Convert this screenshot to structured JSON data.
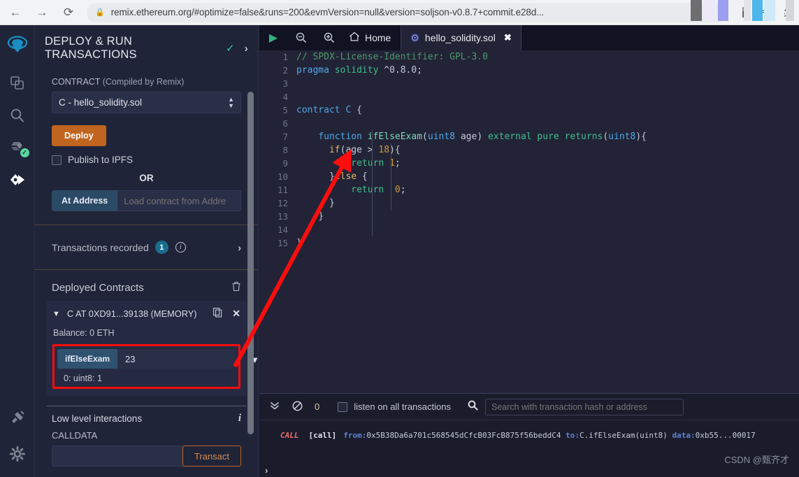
{
  "browser": {
    "back_icon": "back-arrow-icon",
    "forward_icon": "forward-arrow-icon",
    "reload_icon": "reload-icon",
    "lock_icon": "lock-icon",
    "url": "remix.ethereum.org/#optimize=false&runs=200&evmVersion=null&version=soljson-v0.8.7+commit.e28d...",
    "translate_icon": "translate-icon",
    "share_icon": "share-icon",
    "bookmark_icon": "star-icon"
  },
  "rail": {
    "items": [
      {
        "name": "remix-logo",
        "glyph": "◉"
      },
      {
        "name": "file-explorer-icon",
        "glyph": "❐"
      },
      {
        "name": "search-icon",
        "glyph": "⌕"
      },
      {
        "name": "solidity-compiler-icon",
        "glyph": "⚙",
        "badge": "✓"
      },
      {
        "name": "deploy-run-icon",
        "glyph": "◈"
      },
      {
        "name": "plugin-manager-icon",
        "glyph": "⚡"
      },
      {
        "name": "settings-icon",
        "glyph": "⚙"
      }
    ]
  },
  "sidebar": {
    "title": "DEPLOY & RUN TRANSACTIONS",
    "title_check": "✓",
    "title_chevron": "›",
    "contract_label": "CONTRACT",
    "contract_sub": "(Compiled by Remix)",
    "contract_value": "C - hello_solidity.sol",
    "deploy_label": "Deploy",
    "publish_ipfs_label": "Publish to IPFS",
    "or_label": "OR",
    "at_address_label": "At Address",
    "at_address_placeholder": "Load contract from Addre",
    "transactions_recorded_label": "Transactions recorded",
    "transactions_recorded_count": "1",
    "deployed_contracts_label": "Deployed Contracts",
    "contract_instance": "C AT 0XD91...39138 (MEMORY)",
    "balance": "Balance: 0 ETH",
    "fn_name": "ifElseExam",
    "fn_arg_value": "23",
    "fn_result": "0: uint8: 1",
    "low_level_label": "Low level interactions",
    "calldata_label": "CALLDATA",
    "calldata_value": "",
    "transact_label": "Transact"
  },
  "editor": {
    "run_icon": "run-script-icon",
    "zoom_out_icon": "zoom-out-icon",
    "zoom_in_icon": "zoom-in-icon",
    "home_icon": "home-icon",
    "home_label": "Home",
    "tab_label": "hello_solidity.sol",
    "tab_close": "✖",
    "lines": [
      {
        "n": "1",
        "tokens": [
          {
            "t": "// SPDX-License-Identifier: GPL-3.0",
            "c": "c-com"
          }
        ]
      },
      {
        "n": "2",
        "tokens": [
          {
            "t": "pragma ",
            "c": "c-key"
          },
          {
            "t": "solidity ",
            "c": "c-mod"
          },
          {
            "t": "^0.8.0;",
            "c": "c-punct"
          }
        ]
      },
      {
        "n": "3",
        "tokens": []
      },
      {
        "n": "4",
        "tokens": []
      },
      {
        "n": "5",
        "tokens": [
          {
            "t": "contract ",
            "c": "c-key"
          },
          {
            "t": "C ",
            "c": "c-type"
          },
          {
            "t": "{",
            "c": "c-punct"
          }
        ]
      },
      {
        "n": "6",
        "tokens": []
      },
      {
        "n": "7",
        "tokens": [
          {
            "t": "    ",
            "c": ""
          },
          {
            "t": "function ",
            "c": "c-key"
          },
          {
            "t": "ifElseExam",
            "c": "c-fn"
          },
          {
            "t": "(",
            "c": "c-punct"
          },
          {
            "t": "uint8",
            "c": "c-type"
          },
          {
            "t": " age) ",
            "c": "c-punct"
          },
          {
            "t": "external pure ",
            "c": "c-mod"
          },
          {
            "t": "returns",
            "c": "c-ret"
          },
          {
            "t": "(",
            "c": "c-punct"
          },
          {
            "t": "uint8",
            "c": "c-type"
          },
          {
            "t": "){",
            "c": "c-punct"
          }
        ]
      },
      {
        "n": "8",
        "tokens": [
          {
            "t": "      ",
            "c": ""
          },
          {
            "t": "if",
            "c": "c-ctl"
          },
          {
            "t": "(age > ",
            "c": "c-punct"
          },
          {
            "t": "18",
            "c": "c-num"
          },
          {
            "t": "){",
            "c": "c-punct"
          }
        ]
      },
      {
        "n": "9",
        "tokens": [
          {
            "t": "          ",
            "c": ""
          },
          {
            "t": "return ",
            "c": "c-ret"
          },
          {
            "t": "1",
            "c": "c-num"
          },
          {
            "t": ";",
            "c": "c-punct"
          }
        ]
      },
      {
        "n": "10",
        "tokens": [
          {
            "t": "      ",
            "c": ""
          },
          {
            "t": "}",
            "c": "c-punct"
          },
          {
            "t": "else",
            "c": "c-ctl"
          },
          {
            "t": " {",
            "c": "c-punct"
          }
        ]
      },
      {
        "n": "11",
        "tokens": [
          {
            "t": "          ",
            "c": ""
          },
          {
            "t": "return ",
            "c": "c-ret"
          },
          {
            "t": " 0",
            "c": "c-num"
          },
          {
            "t": ";",
            "c": "c-punct"
          }
        ]
      },
      {
        "n": "12",
        "tokens": [
          {
            "t": "      ",
            "c": ""
          },
          {
            "t": "}",
            "c": "c-punct"
          }
        ]
      },
      {
        "n": "13",
        "tokens": [
          {
            "t": "    ",
            "c": ""
          },
          {
            "t": "}",
            "c": "c-punct"
          }
        ]
      },
      {
        "n": "14",
        "tokens": []
      },
      {
        "n": "15",
        "tokens": [
          {
            "t": "}",
            "c": "c-punct"
          }
        ]
      }
    ]
  },
  "terminal": {
    "collapse_icon": "chevron-double-down-icon",
    "clear_icon": "no-entry-icon",
    "pending_count": "0",
    "listen_label": "listen on all transactions",
    "search_icon": "search-icon",
    "search_placeholder": "Search with transaction hash or address",
    "log": {
      "call_label": "CALL",
      "tag": "[call]",
      "from_key": "from:",
      "from_val": "0x5B38Da6a701c568545dCfcB03FcB875f56beddC4",
      "to_key": "to:",
      "to_val": "C.ifElseExam(uint8)",
      "data_key": "data:",
      "data_val": "0xb55...00017"
    },
    "prompt": "›",
    "watermark": "CSDN @甄齐才"
  },
  "colors": {
    "accent_orange": "#c0651f",
    "accent_blue": "#2b4a66",
    "highlight_red": "#fd0d0d",
    "success_green": "#2ecc9b",
    "panel_bg": "#1f2439"
  }
}
